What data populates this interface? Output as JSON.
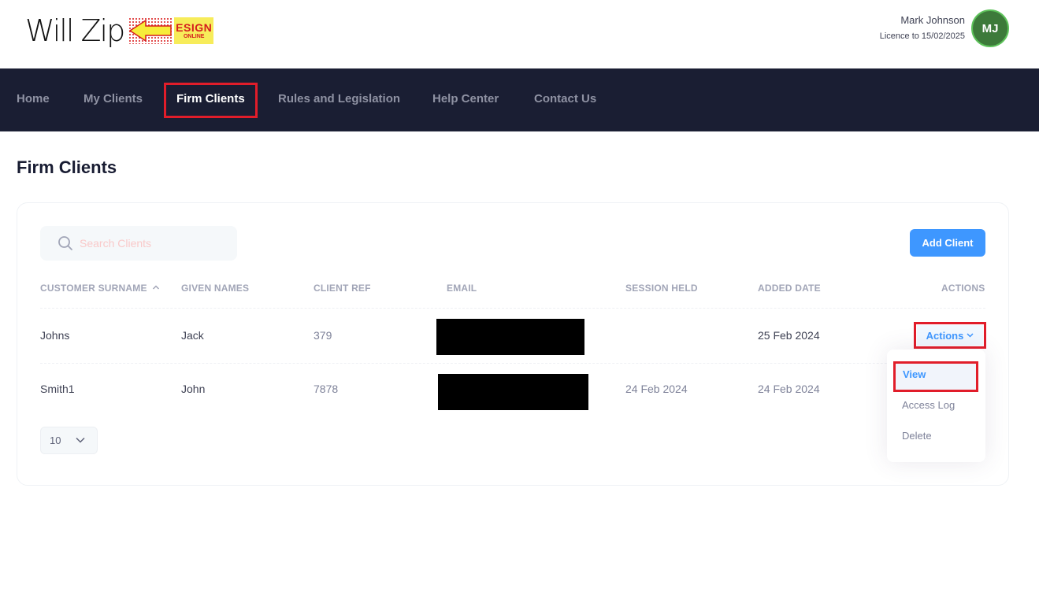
{
  "app": {
    "logo_text": "Will Zip",
    "logo_badge_line1": "ESIGN",
    "logo_badge_line2": "ONLINE"
  },
  "user": {
    "name": "Mark Johnson",
    "licence": "Licence to 15/02/2025",
    "initials": "MJ"
  },
  "nav": {
    "items": [
      {
        "label": "Home",
        "active": false
      },
      {
        "label": "My Clients",
        "active": false
      },
      {
        "label": "Firm Clients",
        "active": true
      },
      {
        "label": "Rules and Legislation",
        "active": false
      },
      {
        "label": "Help Center",
        "active": false
      },
      {
        "label": "Contact Us",
        "active": false
      }
    ]
  },
  "page": {
    "title": "Firm Clients"
  },
  "toolbar": {
    "search_placeholder": "Search Clients",
    "add_button": "Add Client"
  },
  "table": {
    "headers": [
      "CUSTOMER SURNAME",
      "GIVEN NAMES",
      "CLIENT REF",
      "EMAIL",
      "SESSION HELD",
      "ADDED DATE",
      "ACTIONS"
    ],
    "rows": [
      {
        "surname": "Johns",
        "given": "Jack",
        "ref": "379",
        "email": "[redacted]",
        "session": "",
        "added": "25 Feb 2024"
      },
      {
        "surname": "Smith1",
        "given": "John",
        "ref": "7878",
        "email": "[redacted]",
        "session": "24 Feb 2024",
        "added": "24 Feb 2024"
      }
    ]
  },
  "actions_menu": {
    "button_label": "Actions",
    "items": [
      "View",
      "Access Log",
      "Delete"
    ]
  },
  "pagination": {
    "page_size": "10"
  },
  "colors": {
    "nav_bg": "#1a1e33",
    "primary": "#3e97ff",
    "highlight": "#e11d2a",
    "avatar": "#3d7a3a"
  }
}
